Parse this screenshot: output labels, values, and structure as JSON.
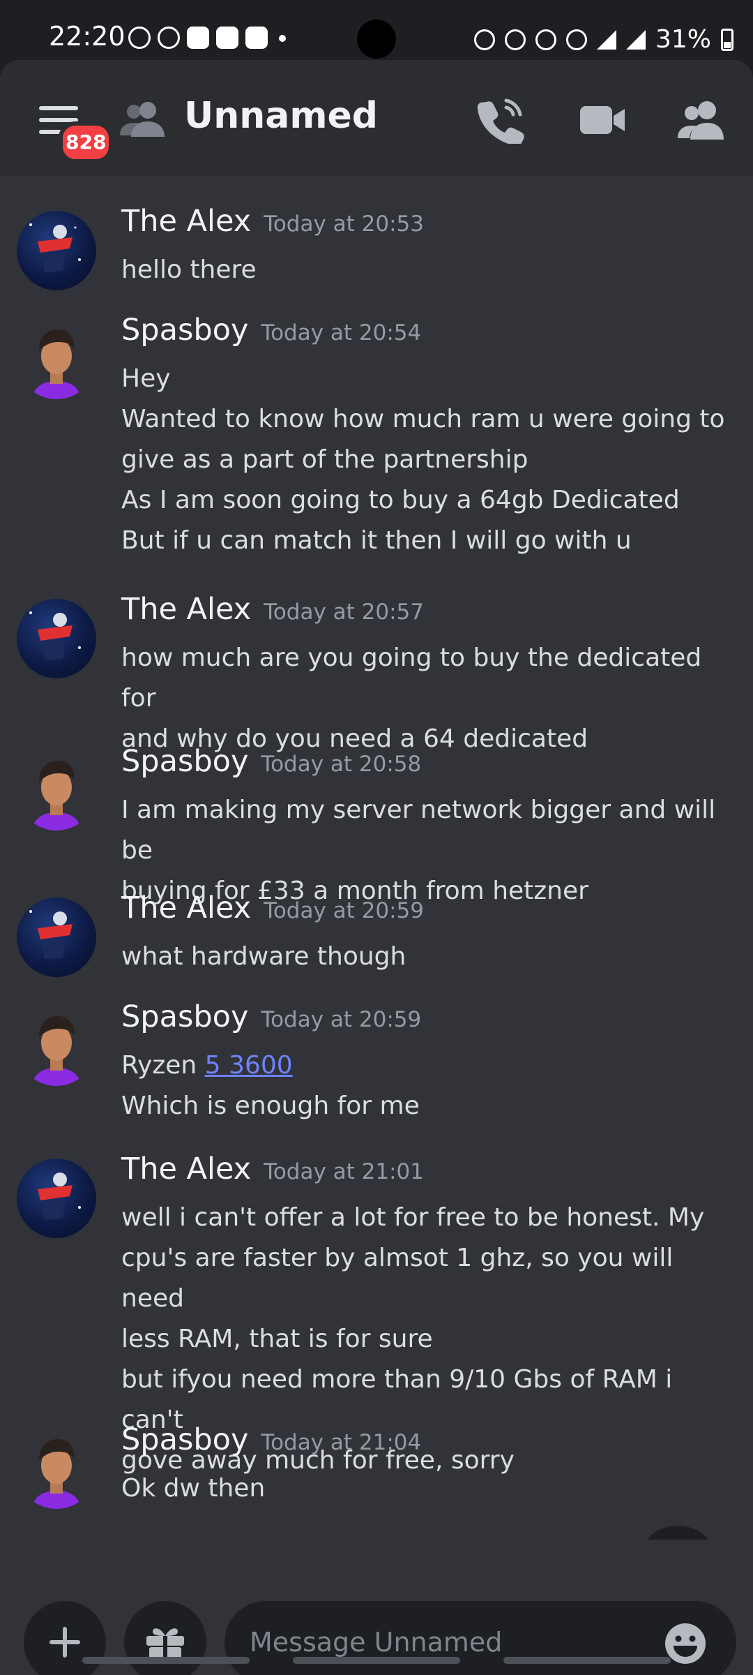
{
  "status_bar": {
    "time": "22:20",
    "battery": "31%",
    "notification_icons": [
      "do-not-disturb-icon",
      "whatsapp-icon",
      "snapchat-icon",
      "discord-icon",
      "discord-icon"
    ],
    "system_icons": [
      "battery-saver-icon",
      "alarm-icon",
      "mute-icon",
      "wifi-icon",
      "signal-icon",
      "signal-icon"
    ]
  },
  "header": {
    "title": "Unnamed",
    "unread_badge": "828",
    "icons": [
      "menu-icon",
      "friends-icon",
      "voice-call-icon",
      "video-call-icon",
      "members-icon"
    ]
  },
  "messages": [
    {
      "author": "The Alex",
      "time": "Today at 20:53",
      "lines": [
        "hello there"
      ]
    },
    {
      "author": "Spasboy",
      "time": "Today at 20:54",
      "lines": [
        "Hey",
        "Wanted to know how much ram u were going to",
        "give as a part of the partnership",
        "As I am soon going to buy a 64gb Dedicated",
        "But if u can match it then I will go with u"
      ]
    },
    {
      "author": "The Alex",
      "time": "Today at 20:57",
      "lines": [
        "how much are you going to buy the dedicated for",
        "and why do you need a 64 dedicated"
      ]
    },
    {
      "author": "Spasboy",
      "time": "Today at 20:58",
      "lines": [
        "I am making my server network bigger and will be",
        "buying for £33 a month from hetzner"
      ]
    },
    {
      "author": "The Alex",
      "time": "Today at 20:59",
      "lines": [
        "what hardware though"
      ]
    },
    {
      "author": "Spasboy",
      "time": "Today at 20:59",
      "line1_prefix": "Ryzen ",
      "line1_link": "5 3600",
      "lines": [
        "Which is enough for me"
      ]
    },
    {
      "author": "The Alex",
      "time": "Today at 21:01",
      "lines": [
        "well i can't offer a lot for free to be honest. My",
        "cpu's are faster by almsot 1 ghz, so you will need",
        "less RAM, that is for sure",
        "but ifyou need more than 9/10 Gbs of RAM i can't",
        "gove away much for free, sorry"
      ]
    },
    {
      "author": "Spasboy",
      "time": "Today at 21:04",
      "lines": [
        "Ok dw then"
      ]
    }
  ],
  "composer": {
    "placeholder": "Message Unnamed"
  },
  "colors": {
    "background": "#313338",
    "header": "#2b2d31",
    "badge": "#f23f43",
    "link": "#6e83ff"
  }
}
